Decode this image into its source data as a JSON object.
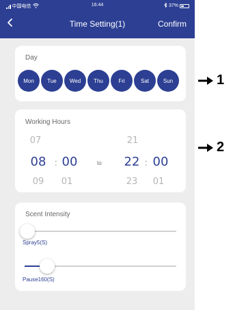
{
  "status_bar": {
    "carrier": "中国电信",
    "time": "16:44",
    "battery": "37%"
  },
  "nav": {
    "title": "Time Setting(1)",
    "confirm": "Confirm"
  },
  "day_section": {
    "label": "Day",
    "days": [
      "Mon",
      "Tue",
      "Wed",
      "Thu",
      "Fri",
      "Sat",
      "Sun"
    ]
  },
  "hours_section": {
    "label": "Working Hours",
    "start": {
      "prev_hour": "07",
      "hour": "08",
      "minute": "00",
      "next_hour": "09",
      "next_minute": "01"
    },
    "separator": "to",
    "end": {
      "prev_hour": "21",
      "hour": "22",
      "minute": "00",
      "next_hour": "23",
      "next_minute": "01"
    }
  },
  "scent_section": {
    "label": "Scent Intensity",
    "spray": {
      "label": "Spray5(S)",
      "fraction": 0.02
    },
    "pause": {
      "label": "Pause160(S)",
      "fraction": 0.15
    }
  },
  "annotations": [
    "1",
    "2"
  ],
  "colors": {
    "primary": "#2c3f93",
    "background": "#ededed",
    "card": "#ffffff"
  }
}
